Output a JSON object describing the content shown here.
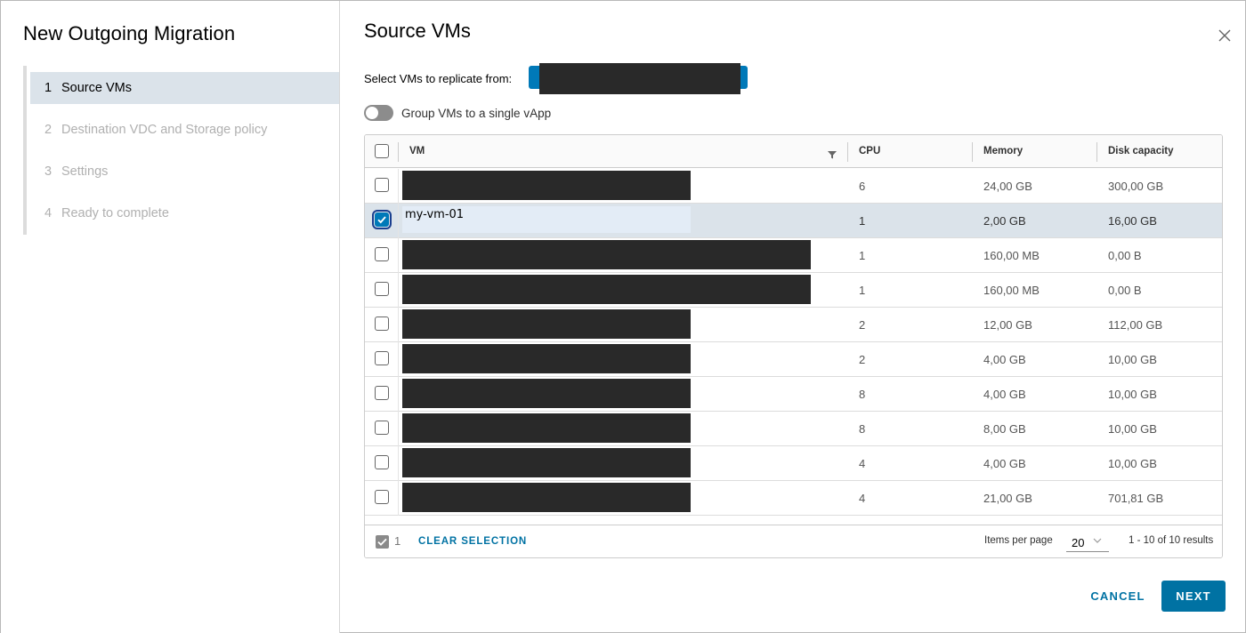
{
  "wizard": {
    "title": "New Outgoing Migration",
    "steps": [
      {
        "num": "1",
        "label": "Source VMs"
      },
      {
        "num": "2",
        "label": "Destination VDC and Storage policy"
      },
      {
        "num": "3",
        "label": "Settings"
      },
      {
        "num": "4",
        "label": "Ready to complete"
      }
    ]
  },
  "main": {
    "title": "Source VMs",
    "close_icon": "close-icon",
    "replicate_label": "Select VMs to replicate from:",
    "group_toggle_label": "Group VMs to a single vApp",
    "group_toggle_on": false
  },
  "grid": {
    "columns": [
      "VM",
      "CPU",
      "Memory",
      "Disk capacity"
    ],
    "rows": [
      {
        "vm": "",
        "cpu": "6",
        "memory": "24,00 GB",
        "disk": "300,00 GB",
        "selected": false
      },
      {
        "vm": "my-vm-01",
        "cpu": "1",
        "memory": "2,00 GB",
        "disk": "16,00 GB",
        "selected": true
      },
      {
        "vm": "",
        "cpu": "1",
        "memory": "160,00 MB",
        "disk": "0,00 B",
        "selected": false
      },
      {
        "vm": "",
        "cpu": "1",
        "memory": "160,00 MB",
        "disk": "0,00 B",
        "selected": false
      },
      {
        "vm": "",
        "cpu": "2",
        "memory": "12,00 GB",
        "disk": "112,00 GB",
        "selected": false
      },
      {
        "vm": "",
        "cpu": "2",
        "memory": "4,00 GB",
        "disk": "10,00 GB",
        "selected": false
      },
      {
        "vm": "",
        "cpu": "8",
        "memory": "4,00 GB",
        "disk": "10,00 GB",
        "selected": false
      },
      {
        "vm": "",
        "cpu": "8",
        "memory": "8,00 GB",
        "disk": "10,00 GB",
        "selected": false
      },
      {
        "vm": "",
        "cpu": "4",
        "memory": "4,00 GB",
        "disk": "10,00 GB",
        "selected": false
      },
      {
        "vm": "",
        "cpu": "4",
        "memory": "21,00 GB",
        "disk": "701,81 GB",
        "selected": false
      }
    ],
    "footer": {
      "selected_count": "1",
      "clear_selection": "CLEAR SELECTION",
      "items_per_page_label": "Items per page",
      "items_per_page": "20",
      "results": "1 - 10 of 10 results"
    }
  },
  "buttons": {
    "cancel": "CANCEL",
    "next": "NEXT"
  },
  "colors": {
    "accent": "#0072a3",
    "selected_row": "#dbe3ea",
    "checkbox_checked": "#0079b8"
  }
}
